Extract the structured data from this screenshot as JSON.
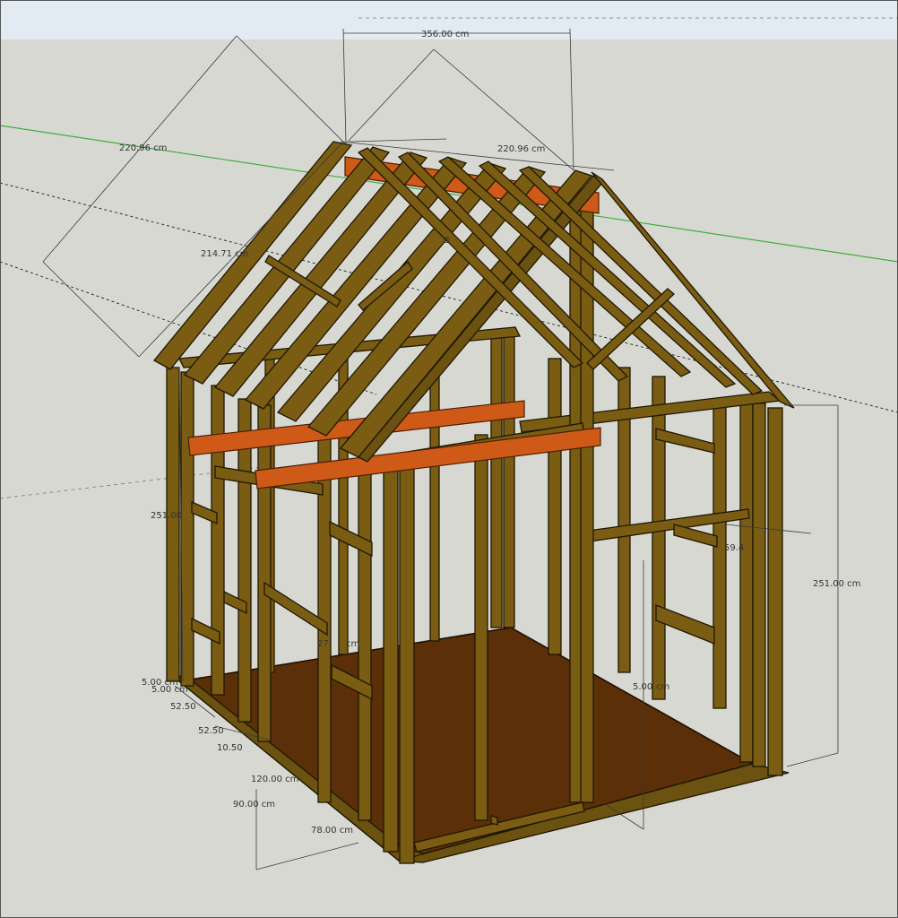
{
  "viewport": {
    "sky_color": "#e1ebf1",
    "ground_color": "#d8d8d3",
    "timber_color": "#7a5d12",
    "ridge_color": "#cf5a17",
    "floor_color": "#5b2f07",
    "green_axis_color": "#3fae3f"
  },
  "dimensions": {
    "top_width": "356.00 cm",
    "rafter_left": "220.96 cm",
    "rafter_right": "220.96 cm",
    "rafter_side": "214.71 cm",
    "wall_height_left": "251.00",
    "wall_height_right": "251.00 cm",
    "partial_right": "59.4",
    "mid_depth": "27",
    "mid_depth_unit": "cm",
    "mid_height": "5.00",
    "mid_height_unit": "cm",
    "base_1": "5.00 cm",
    "base_2": "5.00 cm",
    "base_3": "52.50",
    "base_4": "52.50",
    "base_5": "10.50",
    "base_6": "120.00 cm",
    "base_7": "90.00 cm",
    "base_8": "78.00 cm",
    "small_label": "5"
  }
}
